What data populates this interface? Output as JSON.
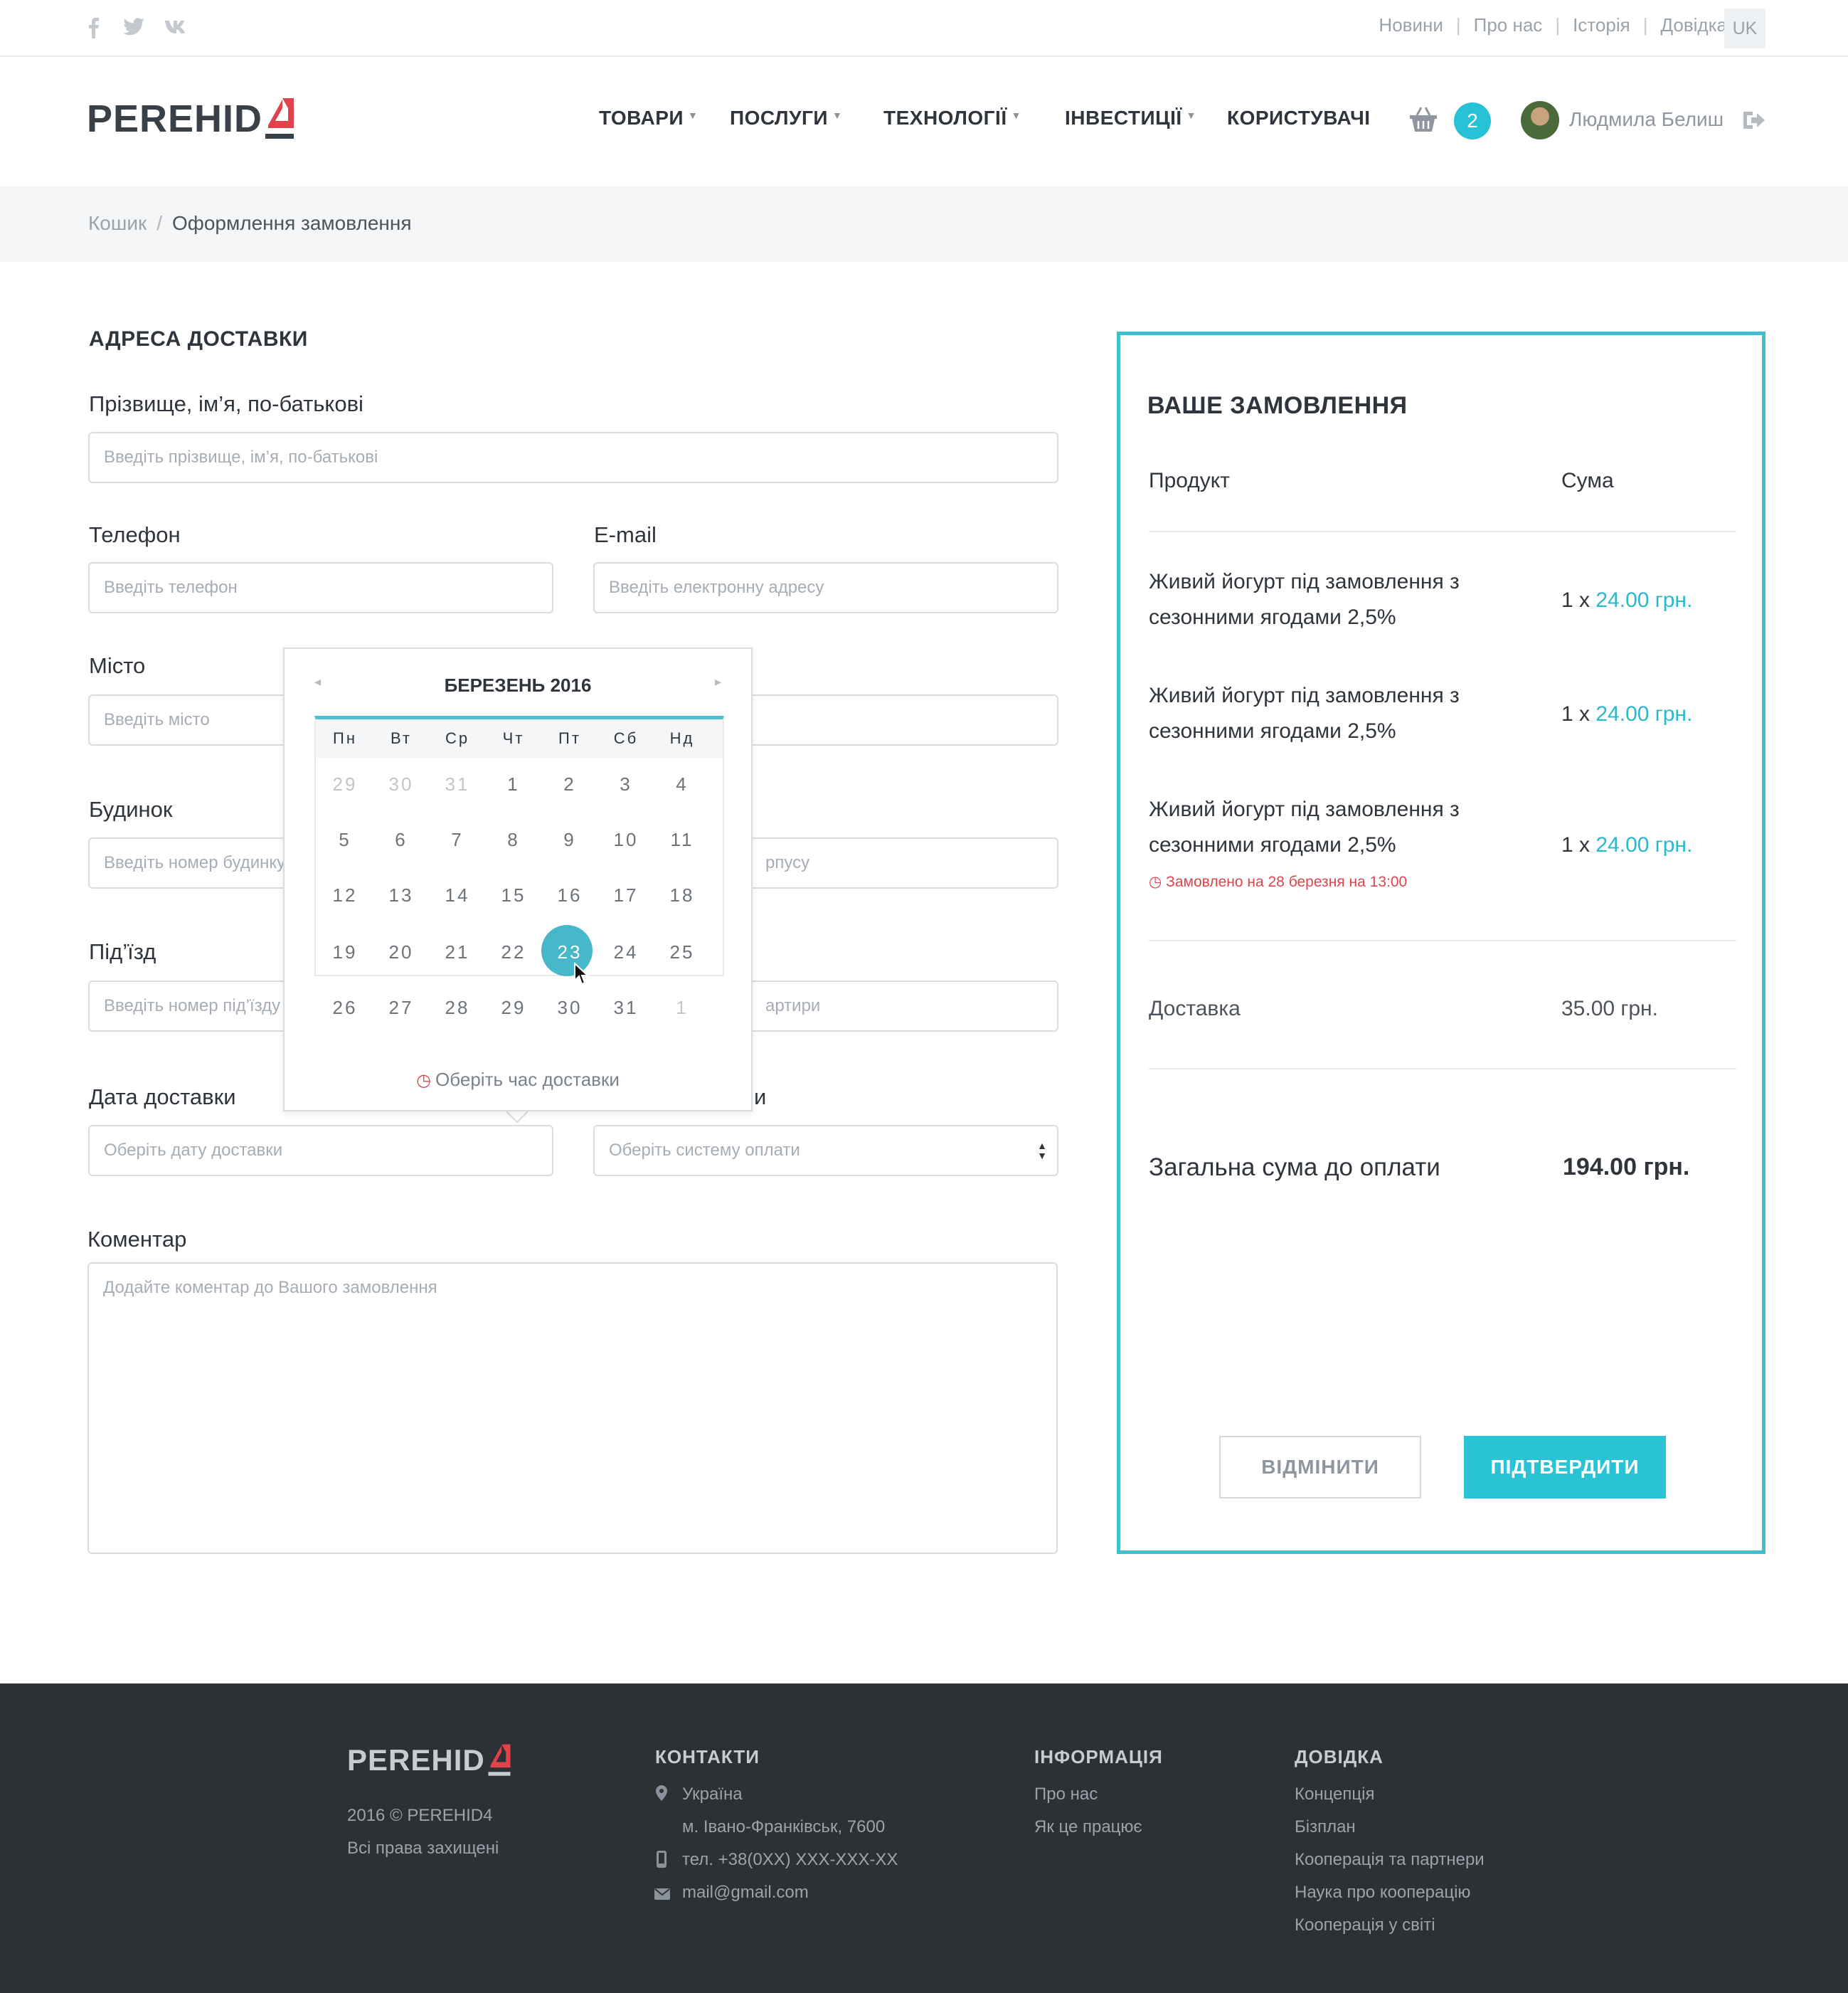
{
  "topbar": {
    "social": [
      "f",
      "t",
      "vk"
    ],
    "links": [
      "Новини",
      "Про нас",
      "Історія",
      "Довідка"
    ],
    "lang": "UK"
  },
  "header": {
    "logo": "PEREHID",
    "logo_mark": "4",
    "nav": [
      "ТОВАРИ",
      "ПОСЛУГИ",
      "ТЕХНОЛОГІЇ",
      "ІНВЕСТИЦІЇ",
      "КОРИСТУВАЧІ"
    ],
    "cart_count": "2",
    "user_name": "Людмила Белиш",
    "icons": [
      "basket-icon",
      "logout-icon"
    ]
  },
  "breadcrumb": {
    "items": [
      "Кошик",
      "Оформлення замовлення"
    ],
    "separator": "/"
  },
  "form": {
    "section_title": "АДРЕСА ДОСТАВКИ",
    "fullname_label": "Прізвище, ім’я, по-батькові",
    "fullname_placeholder": "Введіть прізвище, ім’я, по-батькові",
    "phone_label": "Телефон",
    "phone_placeholder": "Введіть телефон",
    "email_label": "E-mail",
    "email_placeholder": "Введіть електронну адресу",
    "city_label": "Місто",
    "city_placeholder": "Введіть місто",
    "house_label": "Будинок",
    "house_placeholder": "Введіть номер будинку",
    "corpus_placeholder_visible": "рпусу",
    "entrance_label": "Під’їзд",
    "entrance_placeholder": "Введіть номер під’їзду",
    "apartment_placeholder_visible": "артири",
    "date_label": "Дата доставки",
    "date_placeholder": "Оберіть дату доставки",
    "payment_label_visible": "и",
    "payment_placeholder": "Оберіть систему оплати",
    "comment_label": "Коментар",
    "comment_placeholder": "Додайте коментар до Вашого замовлення"
  },
  "calendar": {
    "title": "БЕРЕЗЕНЬ 2016",
    "prev": "◂",
    "next": "▸",
    "weekdays": [
      "Пн",
      "Вт",
      "Ср",
      "Чт",
      "Пт",
      "Сб",
      "Нд"
    ],
    "weeks": [
      [
        "29",
        "30",
        "31",
        "1",
        "2",
        "3",
        "4"
      ],
      [
        "5",
        "6",
        "7",
        "8",
        "9",
        "10",
        "11"
      ],
      [
        "12",
        "13",
        "14",
        "15",
        "16",
        "17",
        "18"
      ],
      [
        "19",
        "20",
        "21",
        "22",
        "23",
        "24",
        "25"
      ],
      [
        "26",
        "27",
        "28",
        "29",
        "30",
        "31",
        "1"
      ]
    ],
    "selected": "23",
    "footer": "Оберіть час доставки"
  },
  "order": {
    "title": "ВАШЕ ЗАМОВЛЕННЯ",
    "col_product": "Продукт",
    "col_sum": "Сума",
    "items": [
      {
        "line1": "Живий йогурт під замовлення з",
        "line2": "сезонними ягодами 2,5%",
        "qty": "1 x",
        "price": "24.00 грн."
      },
      {
        "line1": "Живий йогурт під замовлення з",
        "line2": "сезонними ягодами 2,5%",
        "qty": "1 x",
        "price": "24.00 грн."
      },
      {
        "line1": "Живий йогурт під замовлення з",
        "line2": "сезонними ягодами 2,5%",
        "qty": "1 x",
        "price": "24.00 грн."
      }
    ],
    "note_prefix": "Замовлено на",
    "note_date": "28 березня",
    "note_mid": "на",
    "note_time": "13:00",
    "delivery_label": "Доставка",
    "delivery_value": "35.00 грн.",
    "total_label": "Загальна сума до оплати",
    "total_value": "194.00 грн.",
    "cancel": "ВІДМІНИТИ",
    "confirm": "ПІДТВЕРДИТИ"
  },
  "footer": {
    "logo": "PEREHID",
    "logo_mark": "4",
    "copyright": "2016 © PEREHID4",
    "rights": "Всі права захищені",
    "contacts_title": "КОНТАКТИ",
    "country": "Україна",
    "city": "м. Івано-Франківськ, 7600",
    "phone": "тел. +38(0XX) XXX-XXX-XX",
    "email": "mail@gmail.com",
    "info_title": "ІНФОРМАЦІЯ",
    "info_links": [
      "Про нас",
      "Як це працює"
    ],
    "help_title": "ДОВІДКА",
    "help_links": [
      "Концепція",
      "Бізплан",
      "Кооперація та партнери",
      "Наука про кооперацію",
      "Кооперація у світі"
    ]
  },
  "colors": {
    "accent": "#29c1d6",
    "order_border": "#40bfcc",
    "alert": "#e0434c",
    "footer_bg": "#2d3134"
  }
}
